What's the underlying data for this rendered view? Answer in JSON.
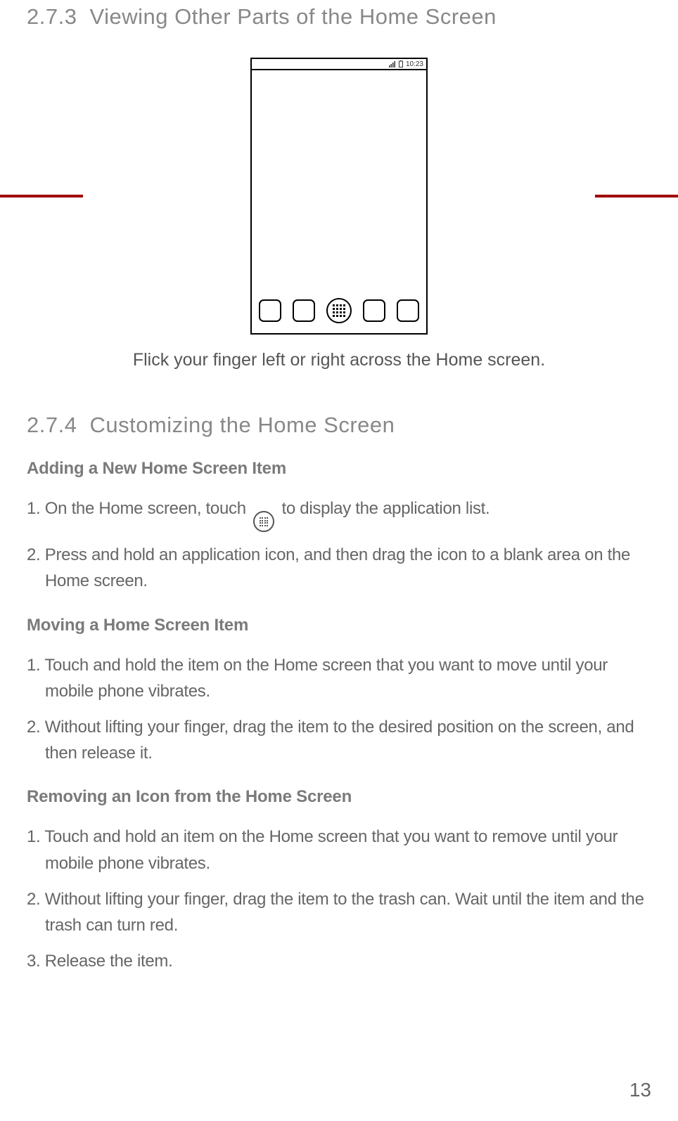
{
  "section_273": {
    "number": "2.7.3",
    "title": "Viewing Other Parts of the Home Screen"
  },
  "phone": {
    "time": "10:23"
  },
  "caption": "Flick your finger left or right across the Home screen.",
  "section_274": {
    "number": "2.7.4",
    "title": "Customizing the Home Screen"
  },
  "adding": {
    "heading": "Adding a New Home Screen Item",
    "step1_a": "1. On the Home screen, touch ",
    "step1_b": " to display the application list.",
    "step2": "2. Press and hold an application icon, and then drag the icon to a blank area on the Home screen."
  },
  "moving": {
    "heading": "Moving a Home Screen Item",
    "step1": "1. Touch and hold the item on the Home screen that you want to move until your mobile phone vibrates.",
    "step2": "2. Without lifting your finger, drag the item to the desired position on the screen, and then release it."
  },
  "removing": {
    "heading": "Removing an Icon from the Home Screen",
    "step1": "1. Touch and hold an item on the Home screen that you want to remove until your mobile phone vibrates.",
    "step2": "2. Without lifting your finger, drag the item to the trash can. Wait until the item and the trash can turn red.",
    "step3": "3. Release the item."
  },
  "page_number": "13"
}
